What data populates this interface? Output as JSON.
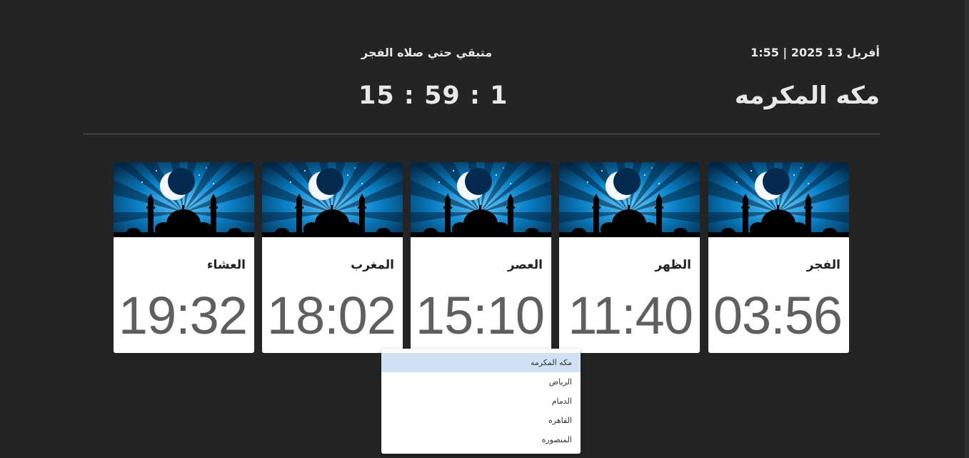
{
  "header": {
    "date_time": "أفريل 13 2025 | 1:55",
    "city": "مكه المكرمه",
    "remaining_label": "متبقي حتي صلاه الفجر",
    "countdown": "15 : 59 : 1"
  },
  "prayers": [
    {
      "name": "الفجر",
      "time": "03:56"
    },
    {
      "name": "الظهر",
      "time": "11:40"
    },
    {
      "name": "العصر",
      "time": "15:10"
    },
    {
      "name": "المغرب",
      "time": "18:02"
    },
    {
      "name": "العشاء",
      "time": "19:32"
    }
  ],
  "city_dropdown": {
    "selected": "مكه المكرمه",
    "options": [
      "مكه المكرمه",
      "الرياض",
      "الدمام",
      "القاهره",
      "المنصوره"
    ]
  },
  "colors": {
    "background": "#242424",
    "card_sky": "#0a7fc4",
    "selected_option": "#cfe1f3"
  }
}
